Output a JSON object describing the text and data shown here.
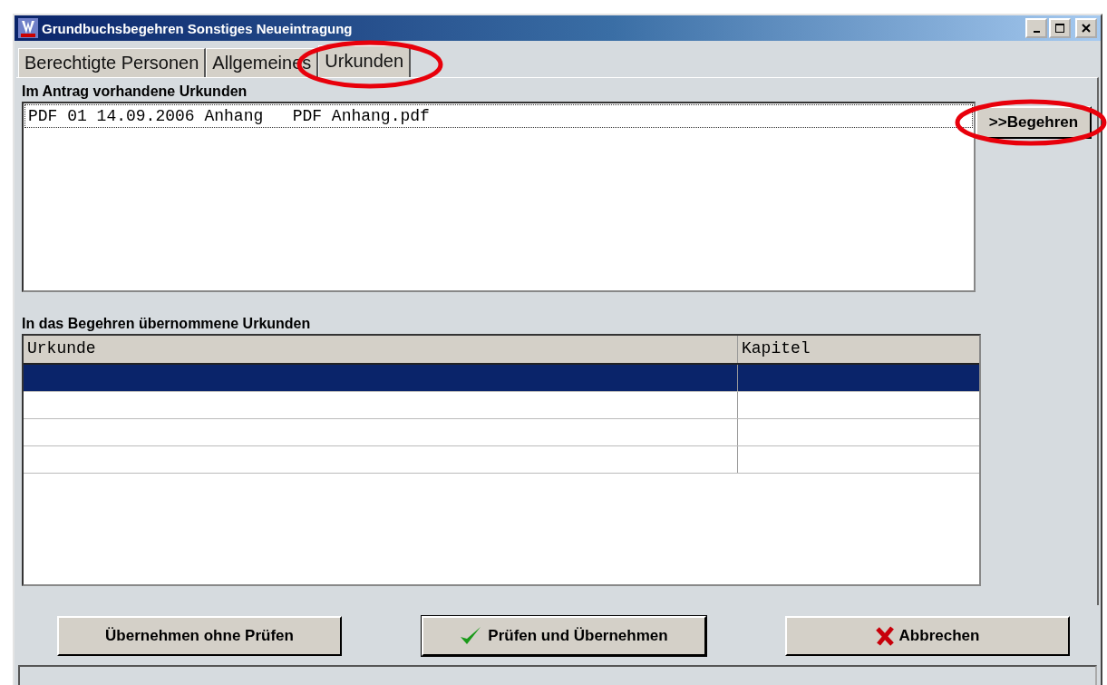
{
  "window": {
    "title": "Grundbuchsbegehren Sonstiges Neueintragung"
  },
  "tabs": [
    {
      "label": "Berechtigte Personen",
      "selected": false,
      "circled": false
    },
    {
      "label": "Allgemeines",
      "selected": false,
      "circled": false
    },
    {
      "label": "Urkunden",
      "selected": true,
      "circled": true
    }
  ],
  "available_documents": {
    "label": "Im Antrag vorhandene Urkunden",
    "rows": [
      {
        "text": "PDF 01 14.09.2006 Anhang   PDF Anhang.pdf",
        "focused": true
      }
    ]
  },
  "add_button": {
    "label": ">>Begehren",
    "circled": true
  },
  "adopted_documents": {
    "label": "In das Begehren übernommene Urkunden",
    "columns": [
      "Urkunde",
      "Kapitel"
    ],
    "rows": [
      {
        "selected": true
      },
      {
        "selected": false
      },
      {
        "selected": false
      },
      {
        "selected": false
      }
    ]
  },
  "buttons": [
    {
      "label": "Übernehmen ohne Prüfen",
      "kind": "plain",
      "default": false
    },
    {
      "label": "Prüfen und Übernehmen",
      "kind": "check",
      "default": true
    },
    {
      "label": "Abbrechen",
      "kind": "cancel",
      "default": false
    }
  ]
}
